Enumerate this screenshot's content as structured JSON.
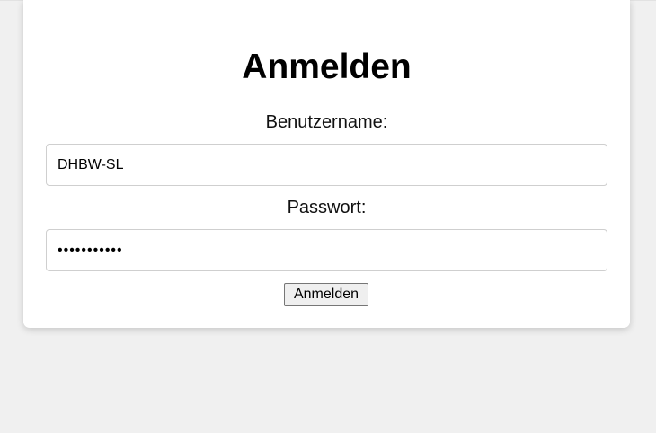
{
  "login_form": {
    "title": "Anmelden",
    "username_label": "Benutzername:",
    "username_value": "DHBW-SL",
    "password_label": "Passwort:",
    "password_value": "•••••••••••",
    "submit_label": "Anmelden"
  },
  "colors": {
    "page_background": "#f0f0f0",
    "card_background": "#ffffff",
    "input_border": "#cfcfcf",
    "button_background": "#efefef"
  }
}
